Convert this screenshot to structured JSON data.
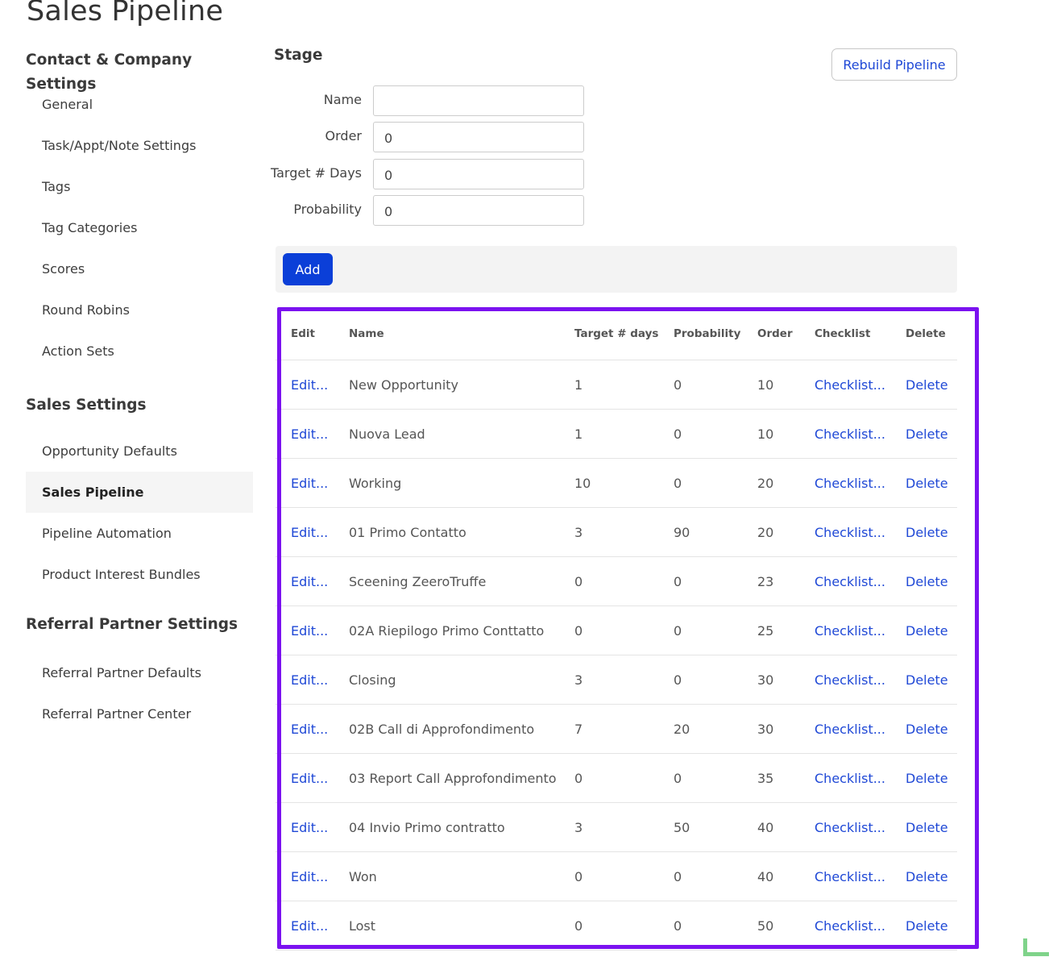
{
  "page": {
    "title": "Sales Pipeline"
  },
  "sidebar": {
    "sections": [
      {
        "heading": "Contact & Company Settings",
        "items": [
          "General",
          "Task/Appt/Note Settings",
          "Tags",
          "Tag Categories",
          "Scores",
          "Round Robins",
          "Action Sets"
        ]
      },
      {
        "heading": "Sales Settings",
        "items": [
          "Opportunity Defaults",
          "Sales Pipeline",
          "Pipeline Automation",
          "Product Interest Bundles"
        ]
      },
      {
        "heading": "Referral Partner Settings",
        "items": [
          "Referral Partner Defaults",
          "Referral Partner Center"
        ]
      }
    ],
    "active_item": "Sales Pipeline"
  },
  "stage_form": {
    "heading": "Stage",
    "rebuild_label": "Rebuild Pipeline",
    "fields": {
      "name": {
        "label": "Name",
        "value": ""
      },
      "order": {
        "label": "Order",
        "value": "0"
      },
      "target_days": {
        "label": "Target # Days",
        "value": "0"
      },
      "probability": {
        "label": "Probability",
        "value": "0"
      }
    },
    "add_label": "Add"
  },
  "table": {
    "columns": [
      "Edit",
      "Name",
      "Target # days",
      "Probability",
      "Order",
      "Checklist",
      "Delete"
    ],
    "edit_link": "Edit...",
    "checklist_link": "Checklist...",
    "delete_link": "Delete",
    "rows": [
      {
        "name": "New Opportunity",
        "target_days": "1",
        "probability": "0",
        "order": "10"
      },
      {
        "name": "Nuova Lead",
        "target_days": "1",
        "probability": "0",
        "order": "10"
      },
      {
        "name": "Working",
        "target_days": "10",
        "probability": "0",
        "order": "20"
      },
      {
        "name": "01 Primo Contatto",
        "target_days": "3",
        "probability": "90",
        "order": "20"
      },
      {
        "name": "Sceening ZeeroTruffe",
        "target_days": "0",
        "probability": "0",
        "order": "23"
      },
      {
        "name": "02A Riepilogo Primo Conttatto",
        "target_days": "0",
        "probability": "0",
        "order": "25"
      },
      {
        "name": "Closing",
        "target_days": "3",
        "probability": "0",
        "order": "30"
      },
      {
        "name": "02B Call di Approfondimento",
        "target_days": "7",
        "probability": "20",
        "order": "30"
      },
      {
        "name": "03 Report Call Approfondimento",
        "target_days": "0",
        "probability": "0",
        "order": "35"
      },
      {
        "name": "04 Invio Primo contratto",
        "target_days": "3",
        "probability": "50",
        "order": "40"
      },
      {
        "name": "Won",
        "target_days": "0",
        "probability": "0",
        "order": "40"
      },
      {
        "name": "Lost",
        "target_days": "0",
        "probability": "0",
        "order": "50"
      }
    ]
  },
  "colors": {
    "link": "#1f48d6",
    "primary_button": "#0b3fd8",
    "highlight_border": "#7b12f0",
    "active_nav_bg": "#f5f5f5"
  }
}
